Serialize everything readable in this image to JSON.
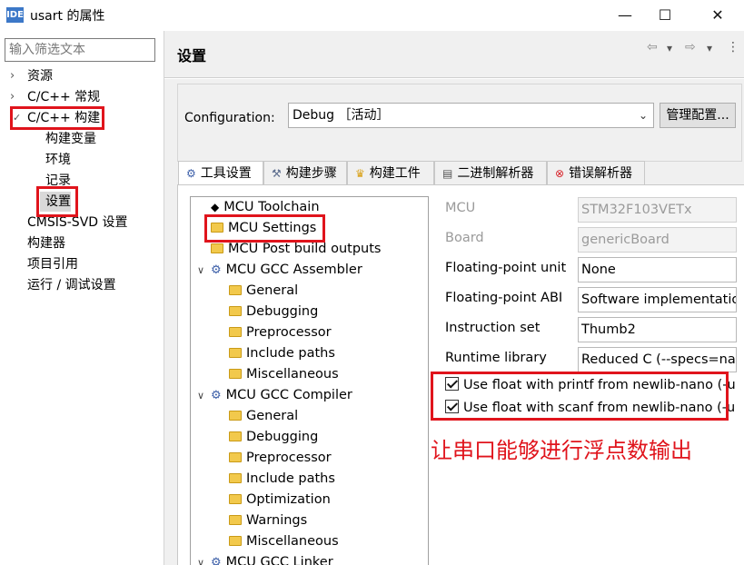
{
  "window": {
    "title": "usart 的属性",
    "app_icon": "IDE",
    "min": "—",
    "max": "☐",
    "close": "✕"
  },
  "left": {
    "filter_placeholder": "输入筛选文本",
    "nav": [
      {
        "label": "资源",
        "arrow": "›"
      },
      {
        "label": "C/C++ 常规",
        "arrow": "›"
      },
      {
        "label": "C/C++ 构建",
        "arrow": "✓"
      },
      {
        "label": "构建变量"
      },
      {
        "label": "环境"
      },
      {
        "label": "记录"
      },
      {
        "label": "设置"
      },
      {
        "label": "CMSIS-SVD 设置"
      },
      {
        "label": "构建器"
      },
      {
        "label": "项目引用"
      },
      {
        "label": "运行 / 调试设置"
      }
    ]
  },
  "header": {
    "title": "设置",
    "back_icon": "⇦",
    "forward_icon": "⇨",
    "drop": "▾",
    "menu_icon": "⋮"
  },
  "config": {
    "label": "Configuration:",
    "value": "Debug ［活动］",
    "manage_button": "管理配置..."
  },
  "tabs": [
    {
      "label": "工具设置",
      "icon": "gear-icon"
    },
    {
      "label": "构建步骤",
      "icon": "hammer-icon"
    },
    {
      "label": "构建工件",
      "icon": "trophy-icon"
    },
    {
      "label": "二进制解析器",
      "icon": "binary-parser-icon"
    },
    {
      "label": "错误解析器",
      "icon": "error-icon"
    }
  ],
  "tree": [
    {
      "label": "MCU Toolchain"
    },
    {
      "label": "MCU Settings"
    },
    {
      "label": "MCU Post build outputs"
    },
    {
      "label": "MCU GCC Assembler"
    },
    {
      "label": "General"
    },
    {
      "label": "Debugging"
    },
    {
      "label": "Preprocessor"
    },
    {
      "label": "Include paths"
    },
    {
      "label": "Miscellaneous"
    },
    {
      "label": "MCU GCC Compiler"
    },
    {
      "label": "General"
    },
    {
      "label": "Debugging"
    },
    {
      "label": "Preprocessor"
    },
    {
      "label": "Include paths"
    },
    {
      "label": "Optimization"
    },
    {
      "label": "Warnings"
    },
    {
      "label": "Miscellaneous"
    },
    {
      "label": "MCU GCC Linker"
    }
  ],
  "fields": [
    {
      "label": "MCU",
      "value": "STM32F103VETx"
    },
    {
      "label": "Board",
      "value": "genericBoard"
    },
    {
      "label": "Floating-point unit",
      "value": "None"
    },
    {
      "label": "Floating-point ABI",
      "value": "Software implementation"
    },
    {
      "label": "Instruction set",
      "value": "Thumb2"
    },
    {
      "label": "Runtime library",
      "value": "Reduced C (--specs=nano.specs)"
    }
  ],
  "checks": [
    {
      "label": "Use float with printf from newlib-nano (-u _printf_float)",
      "checked": true
    },
    {
      "label": "Use float with scanf from newlib-nano (-u _scanf_float)",
      "checked": true
    }
  ],
  "annotation": "让串口能够进行浮点数输出",
  "colors": {
    "highlight_red": "#e0141c",
    "panel_bg": "#f0f0f0",
    "selection": "#cce4f7"
  }
}
